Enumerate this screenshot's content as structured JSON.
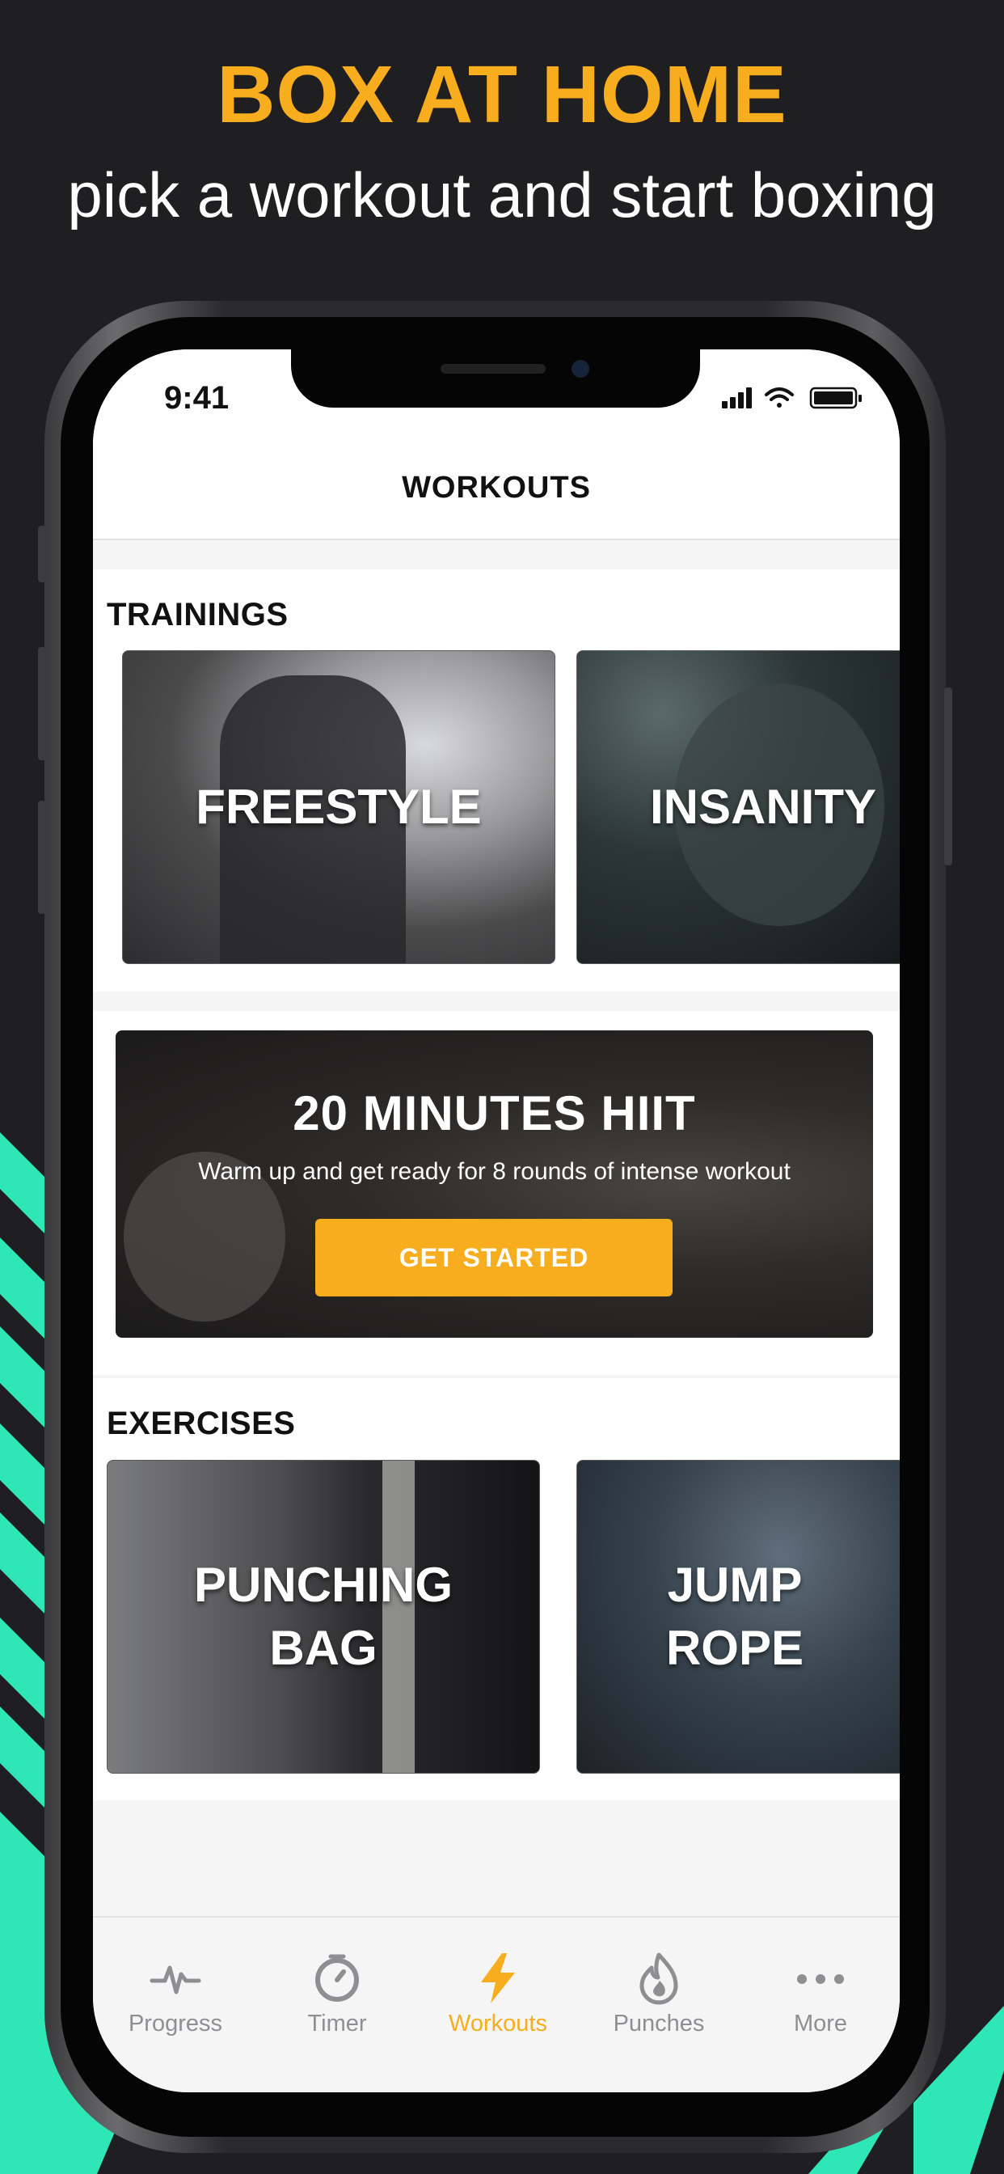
{
  "promo": {
    "headline": "BOX AT HOME",
    "subline": "pick a workout and start boxing"
  },
  "status_bar": {
    "time": "9:41"
  },
  "navbar": {
    "title": "WORKOUTS"
  },
  "trainings": {
    "title": "TRAININGS",
    "cards": [
      {
        "label": "FREESTYLE"
      },
      {
        "label": "INSANITY"
      }
    ]
  },
  "hiit": {
    "title": "20 MINUTES HIIT",
    "subtitle": "Warm up and get ready for 8 rounds of intense workout",
    "button": "GET STARTED"
  },
  "exercises": {
    "title": "EXERCISES",
    "cards": [
      {
        "label": "PUNCHING\nBAG"
      },
      {
        "label": "JUMP\nROPE"
      }
    ]
  },
  "tabbar": {
    "items": [
      {
        "label": "Progress",
        "icon": "pulse-icon"
      },
      {
        "label": "Timer",
        "icon": "timer-icon"
      },
      {
        "label": "Workouts",
        "icon": "lightning-icon",
        "active": true
      },
      {
        "label": "Punches",
        "icon": "flame-icon"
      },
      {
        "label": "More",
        "icon": "more-dots-icon"
      }
    ]
  },
  "colors": {
    "accent": "#f7ad1e",
    "teal": "#2ee6b6",
    "background": "#1f1f21"
  }
}
